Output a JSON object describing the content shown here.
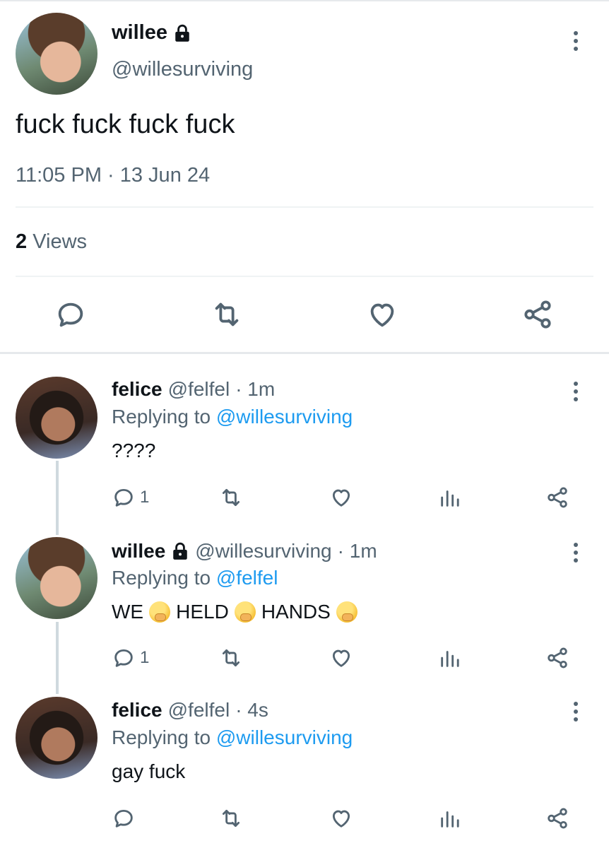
{
  "main_tweet": {
    "display_name": "willee",
    "handle": "@willesurviving",
    "text": "fuck fuck fuck fuck",
    "timestamp": "11:05 PM · 13 Jun 24",
    "views_count": "2",
    "views_label": "Views",
    "actions": [
      "reply-icon",
      "retweet-icon",
      "like-icon",
      "share-icon"
    ]
  },
  "replies": [
    {
      "display_name": "felice",
      "handle": "@felfel",
      "time": "· 1m",
      "replying_prefix": "Replying to",
      "replying_to": "@willesurviving",
      "text": "????",
      "reply_count": "1",
      "locked": false
    },
    {
      "display_name": "willee",
      "handle": "@willesurviving",
      "time": "· 1m",
      "replying_prefix": "Replying to",
      "replying_to": "@felfel",
      "text_parts": [
        "WE",
        "HELD",
        "HANDS"
      ],
      "emoji": "face-with-hand-over-mouth",
      "reply_count": "1",
      "locked": true
    },
    {
      "display_name": "felice",
      "handle": "@felfel",
      "time": "· 4s",
      "replying_prefix": "Replying to",
      "replying_to": "@willesurviving",
      "text": "gay fuck",
      "reply_count": "",
      "locked": false
    }
  ],
  "colors": {
    "text": "#0f1419",
    "secondary": "#536471",
    "link": "#1d9bf0",
    "divider": "#eff3f4"
  }
}
